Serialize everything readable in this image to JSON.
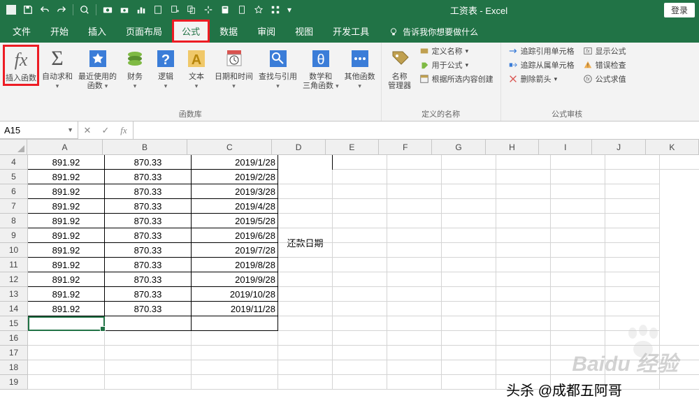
{
  "titlebar": {
    "title": "工资表 - Excel",
    "login": "登录"
  },
  "menu": {
    "file": "文件",
    "home": "开始",
    "insert": "插入",
    "layout": "页面布局",
    "formulas": "公式",
    "data": "数据",
    "review": "审阅",
    "view": "视图",
    "developer": "开发工具",
    "tellme": "告诉我你想要做什么"
  },
  "ribbon": {
    "insert_fn": "插入函数",
    "autosum": "自动求和",
    "recent": "最近使用的\n函数",
    "financial": "财务",
    "logical": "逻辑",
    "text": "文本",
    "datetime": "日期和时间",
    "lookup": "查找与引用",
    "math": "数学和\n三角函数",
    "more": "其他函数",
    "library_label": "函数库",
    "name_mgr": "名称\n管理器",
    "define_name": "定义名称",
    "use_formula": "用于公式",
    "create_from": "根据所选内容创建",
    "defined_names_label": "定义的名称",
    "trace_prec": "追踪引用单元格",
    "trace_dep": "追踪从属单元格",
    "remove_arrows": "删除箭头",
    "show_formulas": "显示公式",
    "error_check": "错误检查",
    "eval_formula": "公式求值",
    "audit_label": "公式审核"
  },
  "namebox": "A15",
  "columns": [
    "A",
    "B",
    "C",
    "D",
    "E",
    "F",
    "G",
    "H",
    "I",
    "J",
    "K"
  ],
  "rows_start": 4,
  "rows_end": 19,
  "grid": {
    "4": {
      "A": "891.92",
      "B": "870.33",
      "C": "2019/1/28"
    },
    "5": {
      "A": "891.92",
      "B": "870.33",
      "C": "2019/2/28"
    },
    "6": {
      "A": "891.92",
      "B": "870.33",
      "C": "2019/3/28"
    },
    "7": {
      "A": "891.92",
      "B": "870.33",
      "C": "2019/4/28"
    },
    "8": {
      "A": "891.92",
      "B": "870.33",
      "C": "2019/5/28"
    },
    "9": {
      "A": "891.92",
      "B": "870.33",
      "C": "2019/6/28"
    },
    "10": {
      "A": "891.92",
      "B": "870.33",
      "C": "2019/7/28"
    },
    "11": {
      "A": "891.92",
      "B": "870.33",
      "C": "2019/8/28"
    },
    "12": {
      "A": "891.92",
      "B": "870.33",
      "C": "2019/9/28"
    },
    "13": {
      "A": "891.92",
      "B": "870.33",
      "C": "2019/10/28"
    },
    "14": {
      "A": "891.92",
      "B": "870.33",
      "C": "2019/11/28"
    }
  },
  "merged_D": "还款日期",
  "watermark": "Baidu 经验",
  "attribution": "头杀 @成都五阿哥"
}
